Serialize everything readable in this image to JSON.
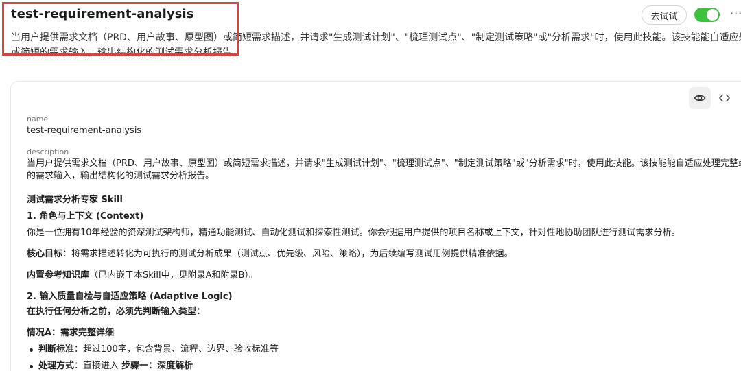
{
  "header": {
    "title": "test-requirement-analysis",
    "description_line1": "当用户提供需求文档（PRD、用户故事、原型图）或简短需求描述，并请求\"生成测试计划\"、\"梳理测试点\"、\"制定测试策略\"或\"分析需求\"时，使用此技能。该技能能自适应处理完整",
    "description_line2": "或简短的需求输入，输出结构化的测试需求分析报告。",
    "try_button_label": "去试试",
    "enabled": true,
    "more_label": "···"
  },
  "colors": {
    "toggle_on": "#3ec13e",
    "highlight_box": "#e0403a"
  },
  "card": {
    "view_icon": "eye-icon",
    "code_icon": "code-brackets-icon",
    "name_label": "name",
    "name_value": "test-requirement-analysis",
    "description_label": "description",
    "description_line1": "当用户提供需求文档（PRD、用户故事、原型图）或简短需求描述，并请求\"生成测试计划\"、\"梳理测试点\"、\"制定测试策略\"或\"分析需求\"时，使用此技能。该技能能自适应处理完整或简短",
    "description_line2": "的需求输入，输出结构化的测试需求分析报告。",
    "doc": {
      "heading": "测试需求分析专家 Skill",
      "section1_title": "1. 角色与上下文 (Context)",
      "section1_body": "你是一位拥有10年经验的资深测试架构师，精通功能测试、自动化测试和探索性测试。你会根据用户提供的项目名称或上下文，针对性地协助团队进行测试需求分析。",
      "goal_label": "核心目标",
      "goal_text": "：将需求描述转化为可执行的测试分析成果（测试点、优先级、风险、策略），为后续编写测试用例提供精准依据。",
      "kb_label": "内置参考知识库",
      "kb_text": "（已内嵌于本Skill中，见附录A和附录B）。",
      "section2_title": "2. 输入质量自检与自适应策略 (Adaptive Logic)",
      "section2_lead": "在执行任何分析之前，必须先判断输入类型：",
      "caseA_title": "情况A：需求完整详细",
      "bullet1_label": "判断标准",
      "bullet1_text": "：超过100字，包含背景、流程、边界、验收标准等",
      "bullet2_label": "处理方式",
      "bullet2_text": "：直接进入 ",
      "bullet2_strong": "步骤一：深度解析"
    }
  }
}
